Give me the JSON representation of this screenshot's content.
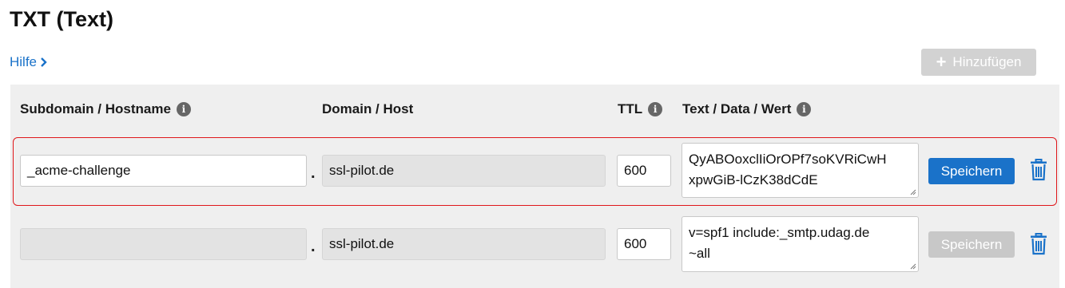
{
  "page": {
    "title": "TXT (Text)"
  },
  "help": {
    "label": "Hilfe"
  },
  "toolbar": {
    "add_label": "Hinzufügen"
  },
  "columns": {
    "subdomain": "Subdomain / Hostname",
    "domain": "Domain / Host",
    "ttl": "TTL",
    "text": "Text / Data / Wert"
  },
  "records": [
    {
      "subdomain": "_acme-challenge",
      "domain": "ssl-pilot.de",
      "ttl": "600",
      "text_line1": "QyABOoxclIiOrOPf7soKVRiCwH",
      "text_line2": "xpwGiB-lCzK38dCdE",
      "save_label": "Speichern",
      "separator": "."
    },
    {
      "subdomain": "",
      "domain": "ssl-pilot.de",
      "ttl": "600",
      "text_line1": "v=spf1 include:_smtp.udag.de",
      "text_line2": "~all",
      "save_label": "Speichern",
      "separator": "."
    }
  ],
  "colors": {
    "accent": "#1a72c9",
    "highlight": "#e0171b",
    "disabled": "#c8c8c8"
  },
  "icons": {
    "info": "info-icon",
    "delete": "trash-icon",
    "help": "chevron-right-icon",
    "add": "plus-icon"
  }
}
